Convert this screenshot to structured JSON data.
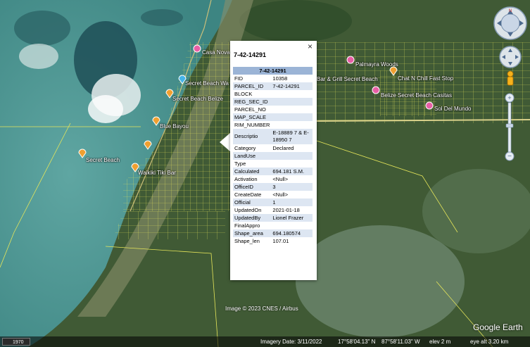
{
  "popup": {
    "title": "7-42-14291",
    "header": "7-42-14291",
    "close": "×",
    "rows": [
      {
        "k": "FID",
        "v": "10358"
      },
      {
        "k": "PARCEL_ID",
        "v": "7-42-14291"
      },
      {
        "k": "BLOCK",
        "v": ""
      },
      {
        "k": "REG_SEC_ID",
        "v": ""
      },
      {
        "k": "PARCEL_NO",
        "v": ""
      },
      {
        "k": "MAP_SCALE",
        "v": ""
      },
      {
        "k": "RIM_NUMBER",
        "v": ""
      },
      {
        "k": "Descriptio",
        "v": "E-18889 7 & E-18950 7"
      },
      {
        "k": "Category",
        "v": "Declared"
      },
      {
        "k": "LandUse",
        "v": ""
      },
      {
        "k": "Type",
        "v": ""
      },
      {
        "k": "Calculated",
        "v": "694.181 S.M."
      },
      {
        "k": "Activation",
        "v": "<Null>"
      },
      {
        "k": "OfficeID",
        "v": "3"
      },
      {
        "k": "CreateDate",
        "v": "<Null>"
      },
      {
        "k": "Official",
        "v": "1"
      },
      {
        "k": "UpdatedOn",
        "v": "2021-01-18"
      },
      {
        "k": "UpdatedBy",
        "v": "Lionel Frazer"
      },
      {
        "k": "FinalAppro",
        "v": ""
      },
      {
        "k": "Shape_area",
        "v": "694.180574"
      },
      {
        "k": "Shape_len",
        "v": "107.01"
      }
    ]
  },
  "places": [
    {
      "name": "Casa Nova",
      "kind": "pink"
    },
    {
      "name": "Secret Beach Wa",
      "kind": "blue"
    },
    {
      "name": "Secret Beach Belize",
      "kind": "orange"
    },
    {
      "name": "Blue Bayou",
      "kind": "orange"
    },
    {
      "name": "Secret Beach",
      "kind": "orange"
    },
    {
      "name": "Waikiki Tiki Bar",
      "kind": "orange"
    },
    {
      "name": "Palmayra Woods",
      "kind": "pink"
    },
    {
      "name": "Bar & Grill Secret Beach",
      "kind": "orange"
    },
    {
      "name": "Chat N Chill Fast Stop",
      "kind": "orange"
    },
    {
      "name": "Belize Secret Beach Casitas",
      "kind": "pink"
    },
    {
      "name": "Sol Del Mundo",
      "kind": "pink"
    }
  ],
  "footer": {
    "copyright": "Image © 2023 CNES / Airbus",
    "imagery_date": "Imagery Date: 3/11/2022",
    "lat": "17°58'04.13\" N",
    "lon": "87°58'11.03\" W",
    "elev": "elev   2 m",
    "eye_alt": "eye alt   3.20 km",
    "historical_year": "1970",
    "logo": "Google Earth"
  }
}
